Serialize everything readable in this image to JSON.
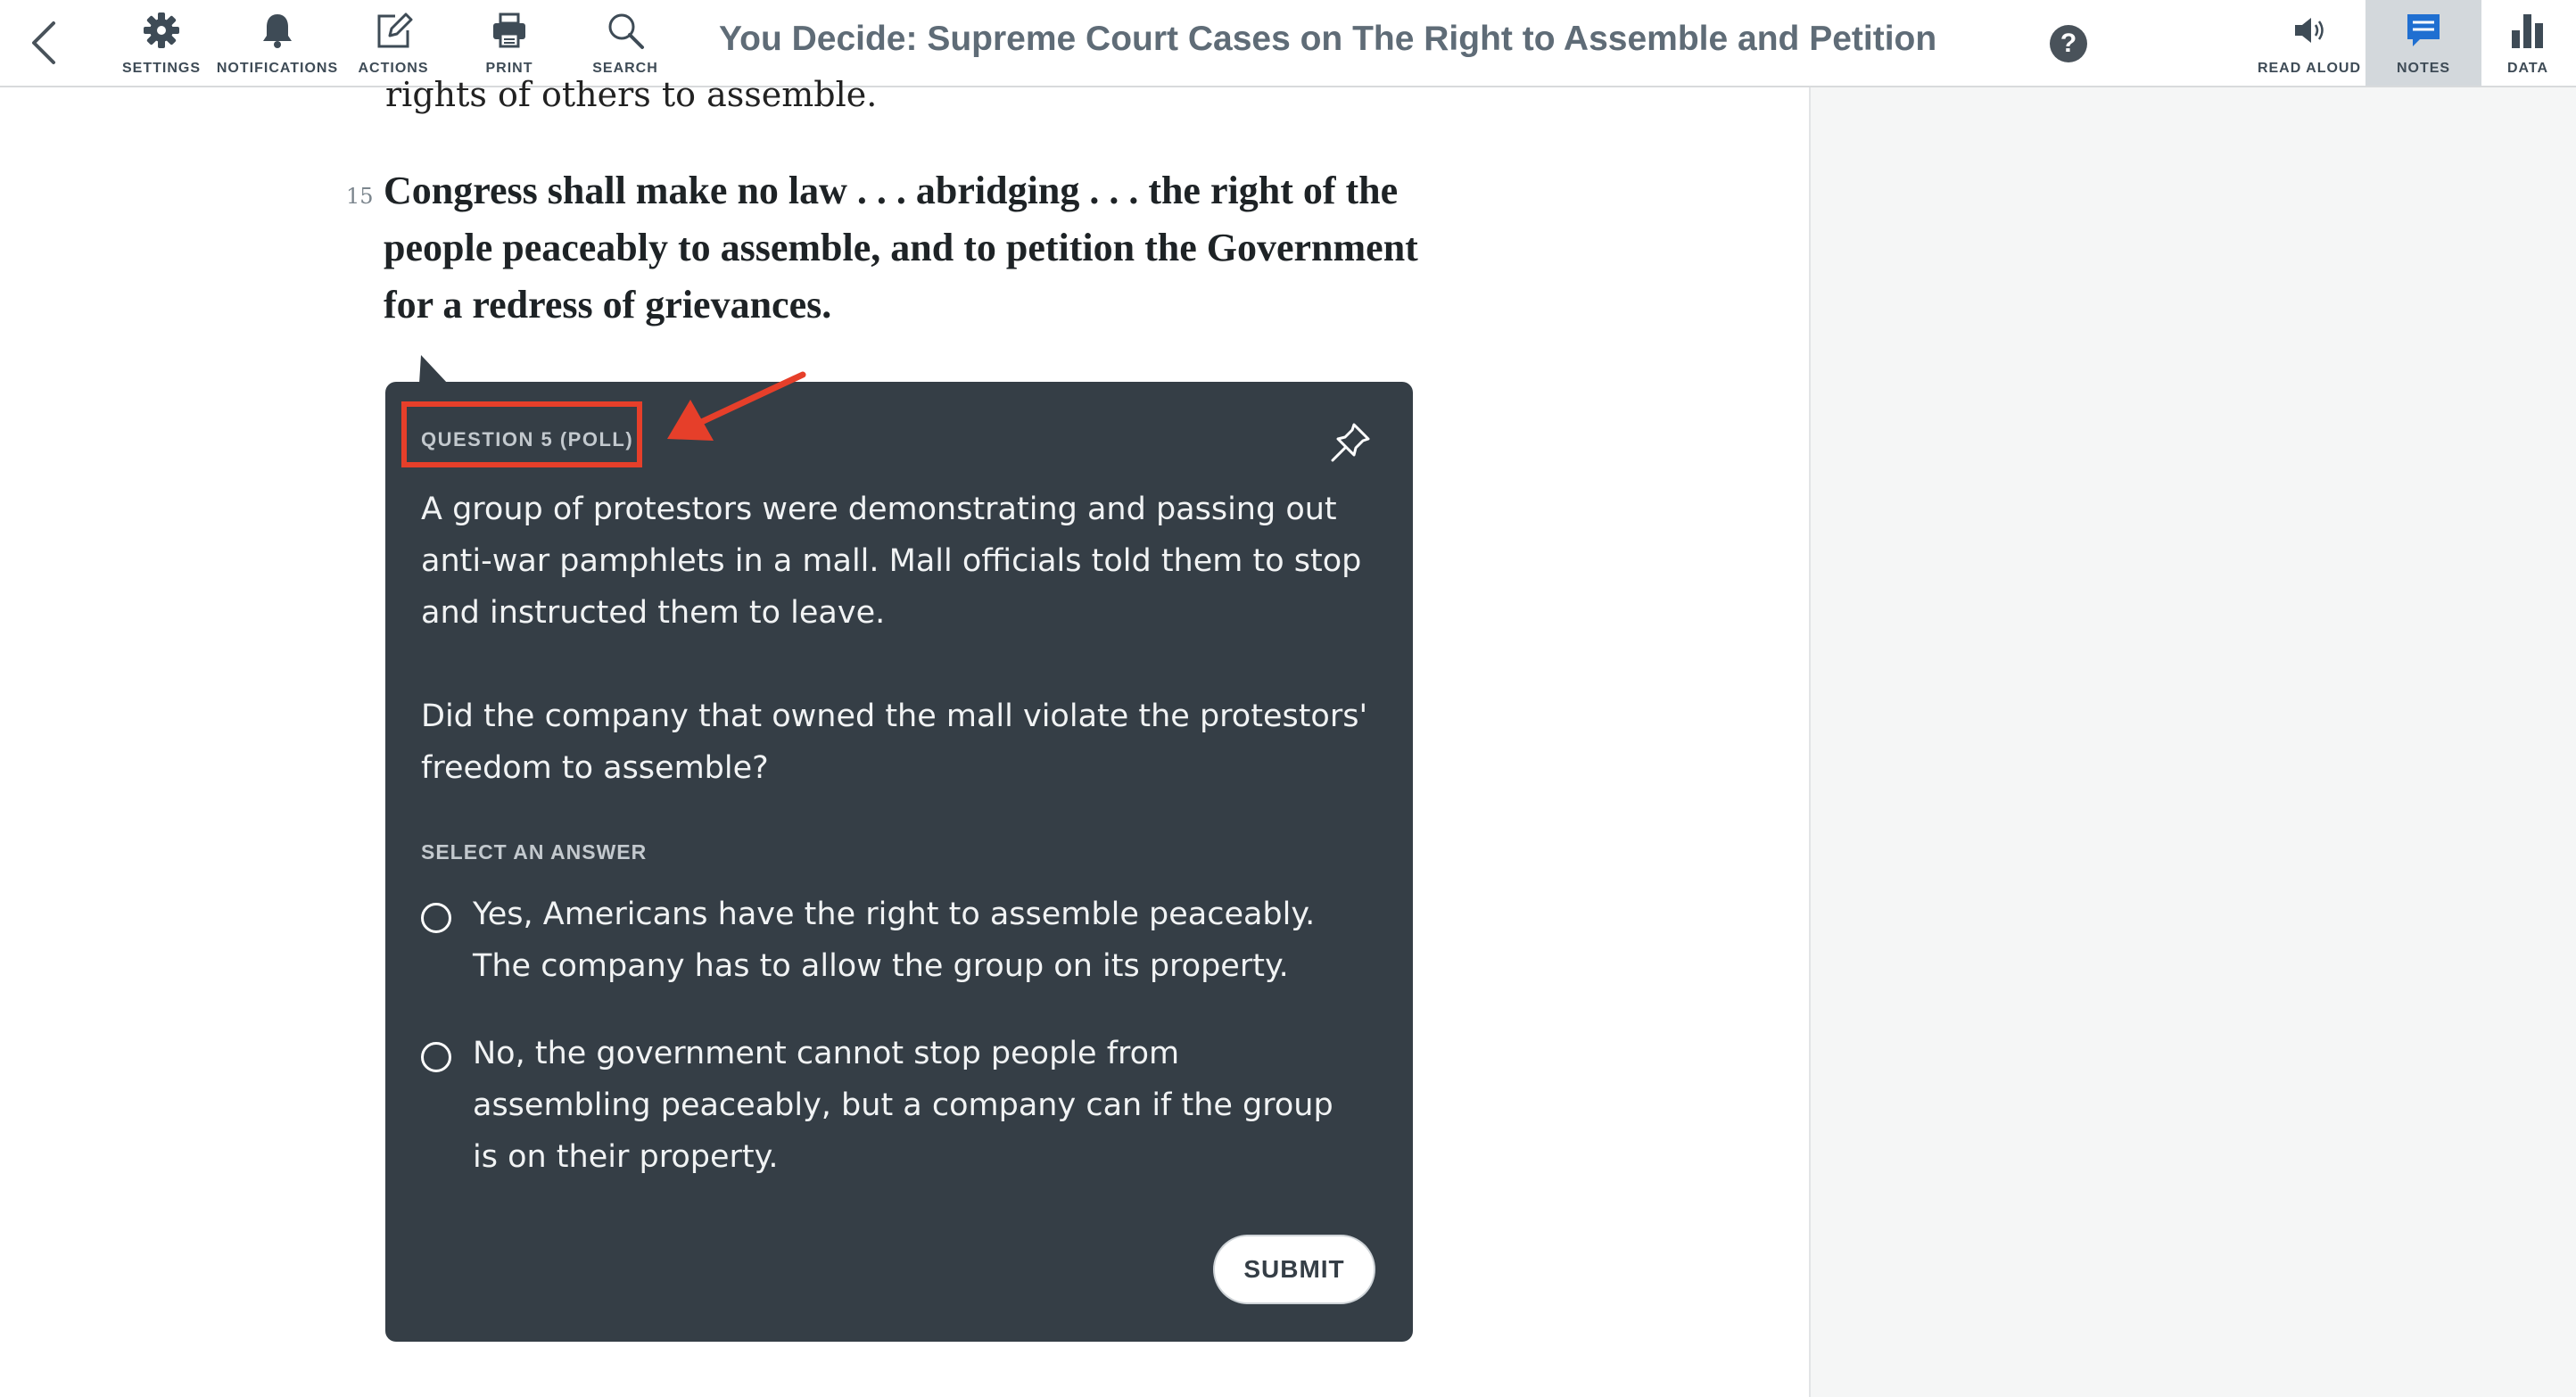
{
  "toolbar": {
    "tools": [
      {
        "label": "SETTINGS",
        "icon": "gear-icon"
      },
      {
        "label": "NOTIFICATIONS",
        "icon": "bell-icon"
      },
      {
        "label": "ACTIONS",
        "icon": "edit-icon"
      },
      {
        "label": "PRINT",
        "icon": "printer-icon"
      },
      {
        "label": "SEARCH",
        "icon": "search-icon"
      }
    ],
    "title": "You Decide: Supreme Court Cases on The Right to Assemble and Petition",
    "help_symbol": "?",
    "right_tools": [
      {
        "label": "READ ALOUD",
        "icon": "speaker-icon"
      },
      {
        "label": "NOTES",
        "icon": "notes-icon",
        "active": true
      },
      {
        "label": "DATA",
        "icon": "bar-chart-icon"
      }
    ]
  },
  "reading": {
    "previous_line": "rights of others to assemble.",
    "line_number": "15",
    "quote": "Congress shall make no law . . . abridging . . . the right of the people peaceably to assemble, and to petition the Government for a redress of grievances."
  },
  "question": {
    "label": "QUESTION 5 (POLL)",
    "prompt_1": "A group of protestors were demonstrating and passing out anti-war pamphlets in a mall. Mall officials told them to stop and instructed them to leave.",
    "prompt_2": "Did the company that owned the mall violate the protestors' freedom to assemble?",
    "select_label": "SELECT AN ANSWER",
    "options": [
      "Yes, Americans have the right to assemble peaceably. The company has to allow the group on its property.",
      "No, the government cannot stop people from assembling peaceably, but a company can if the group is on their property."
    ],
    "submit_label": "SUBMIT"
  },
  "colors": {
    "card_bg": "#353e46",
    "annotation_red": "#e63f2a",
    "toolbar_text": "#3e4b56"
  }
}
